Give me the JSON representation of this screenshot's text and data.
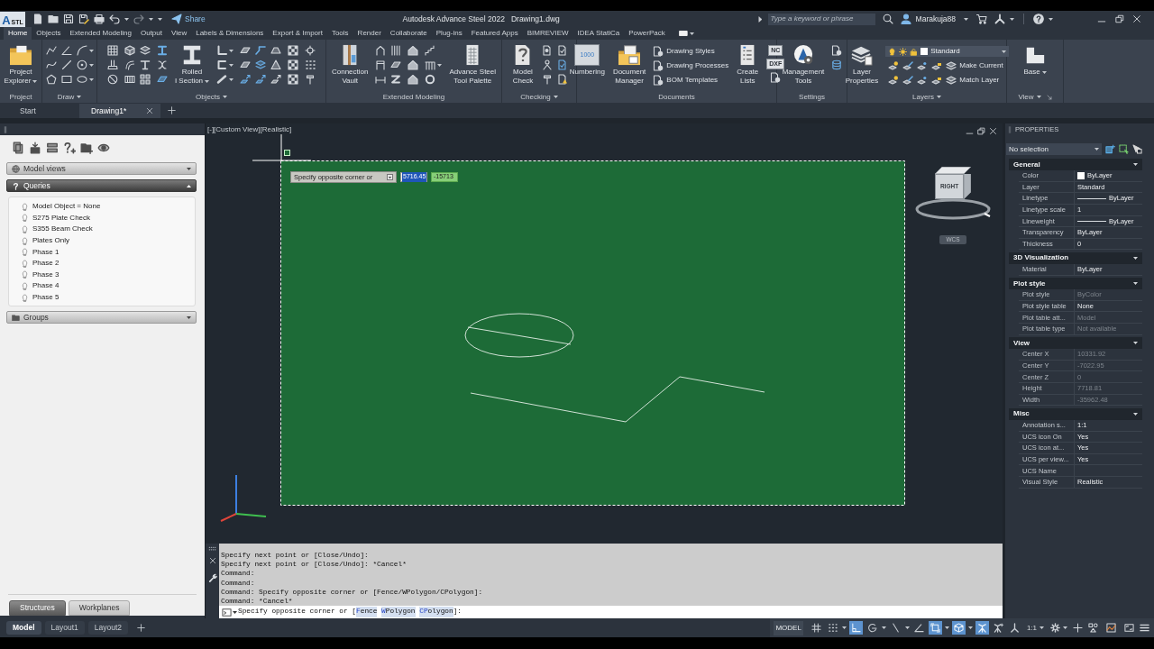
{
  "title_bar": {
    "app_button": {
      "letter": "A",
      "sub": "STL"
    },
    "share": "Share",
    "app_name": "Autodesk Advance Steel 2022",
    "file_name": "Drawing1.dwg",
    "search": {
      "placeholder": "Type a keyword or phrase"
    },
    "user": "Marakuja88"
  },
  "ribbon_tabs": [
    {
      "label": "Home",
      "selected": true
    },
    {
      "label": "Objects",
      "selected": false
    },
    {
      "label": "Extended Modeling",
      "selected": false
    },
    {
      "label": "Output",
      "selected": false
    },
    {
      "label": "View",
      "selected": false
    },
    {
      "label": "Labels & Dimensions",
      "selected": false
    },
    {
      "label": "Export & Import",
      "selected": false
    },
    {
      "label": "Tools",
      "selected": false
    },
    {
      "label": "Render",
      "selected": false
    },
    {
      "label": "Collaborate",
      "selected": false
    },
    {
      "label": "Plug-ins",
      "selected": false
    },
    {
      "label": "Featured Apps",
      "selected": false
    },
    {
      "label": "BIMREVIEW",
      "selected": false
    },
    {
      "label": "IDEA StatiCa",
      "selected": false
    },
    {
      "label": "PowerPack",
      "selected": false
    }
  ],
  "ribbon_panels": [
    {
      "label": "Project",
      "dropdown": false,
      "launcher": false,
      "controls": [
        {
          "kind": "big",
          "lines": [
            "Project",
            "Explorer"
          ],
          "dropdown": true
        }
      ]
    },
    {
      "label": "Draw",
      "dropdown": true,
      "launcher": false,
      "controls": [
        {
          "kind": "icons"
        }
      ]
    },
    {
      "label": "Objects",
      "dropdown": true,
      "launcher": false,
      "controls": [
        {
          "kind": "icons"
        },
        {
          "kind": "icons"
        },
        {
          "kind": "icons"
        },
        {
          "kind": "big",
          "lines": [
            "Rolled",
            "I Section"
          ],
          "dropdown": true
        },
        {
          "kind": "icons"
        },
        {
          "kind": "icons"
        },
        {
          "kind": "icons"
        },
        {
          "kind": "icons"
        }
      ]
    },
    {
      "label": "Extended Modeling",
      "dropdown": false,
      "launcher": false,
      "controls": [
        {
          "kind": "big",
          "lines": [
            "Connection",
            "Vault"
          ],
          "dropdown": false
        },
        {
          "kind": "icons"
        },
        {
          "kind": "icons"
        },
        {
          "kind": "icons"
        },
        {
          "kind": "big",
          "lines": [
            "Advance Steel",
            "Tool Palette"
          ],
          "dropdown": false
        }
      ]
    },
    {
      "label": "Checking",
      "dropdown": true,
      "launcher": false,
      "controls": [
        {
          "kind": "big",
          "lines": [
            "Model",
            "Check"
          ],
          "dropdown": false
        },
        {
          "kind": "icons"
        }
      ]
    },
    {
      "label": "Documents",
      "dropdown": false,
      "launcher": false,
      "controls": [
        {
          "kind": "big",
          "lines": [
            "Numbering"
          ],
          "icon_text": "1000",
          "dropdown": false
        },
        {
          "kind": "big",
          "lines": [
            "Document",
            "Manager"
          ],
          "dropdown": false
        },
        {
          "kind": "list",
          "items": [
            "Drawing Styles",
            "Drawing Processes",
            "BOM Templates"
          ]
        },
        {
          "kind": "big",
          "lines": [
            "Create",
            "Lists"
          ],
          "dropdown": false
        },
        {
          "kind": "file_icons",
          "labels": [
            "NC",
            "DXF"
          ]
        }
      ]
    },
    {
      "label": "Settings",
      "dropdown": false,
      "launcher": false,
      "controls": [
        {
          "kind": "big",
          "lines": [
            "Management",
            "Tools"
          ],
          "dropdown": false
        },
        {
          "kind": "icons"
        }
      ]
    },
    {
      "label": "Layers",
      "dropdown": true,
      "launcher": false,
      "controls": [
        {
          "kind": "big",
          "lines": [
            "Layer",
            "Properties"
          ],
          "dropdown": false
        },
        {
          "kind": "layer_tools",
          "layer": "Standard",
          "actions": [
            "Make Current",
            "Match Layer"
          ]
        }
      ]
    },
    {
      "label": "View",
      "dropdown": true,
      "launcher": true,
      "controls": [
        {
          "kind": "big",
          "lines": [
            "Base"
          ],
          "dropdown": true
        }
      ]
    }
  ],
  "document_tabs": [
    {
      "label": "Start",
      "selected": false,
      "closable": false
    },
    {
      "label": "Drawing1*",
      "selected": true,
      "closable": true
    }
  ],
  "structure_panel": {
    "sections": [
      {
        "title": "Model views",
        "kind": "views",
        "expanded": false
      },
      {
        "title": "Queries",
        "kind": "queries",
        "expanded": true,
        "items": [
          "Model Object = None",
          "S275 Plate Check",
          "S355 Beam Check",
          "Plates Only",
          "Phase 1",
          "Phase 2",
          "Phase 3",
          "Phase 4",
          "Phase 5"
        ]
      },
      {
        "title": "Groups",
        "kind": "groups",
        "expanded": false
      }
    ],
    "tabs": [
      {
        "label": "Structures",
        "selected": true
      },
      {
        "label": "Workplanes",
        "selected": false
      }
    ]
  },
  "viewport": {
    "controls": "[-][Custom View][Realistic]",
    "dynamic_input": {
      "prompt": "Specify opposite corner or",
      "fields": [
        {
          "value": "5716.45",
          "selected": true
        },
        {
          "value": "-15713",
          "selected": false
        }
      ]
    },
    "viewcube": {
      "face": "RIGHT",
      "ucs": "WCS"
    }
  },
  "command_line": {
    "history": [
      "Specify next point or [Close/Undo]:",
      "Specify next point or [Close/Undo]: *Cancel*",
      "Command:",
      "Command:",
      "Command: Specify opposite corner or [Fence/WPolygon/CPolygon]:",
      "Command: *Cancel*"
    ],
    "prompt": {
      "text": "Specify opposite corner or [",
      "options": [
        {
          "key": "F",
          "rest": "ence"
        },
        {
          "key": "W",
          "rest": "Polygon"
        },
        {
          "key": "CP",
          "rest": "olygon"
        }
      ],
      "end": "]:"
    }
  },
  "properties": {
    "title": "PROPERTIES",
    "selection": "No selection",
    "sections": [
      {
        "title": "General",
        "expanded": true,
        "rows": [
          {
            "label": "Color",
            "value": "ByLayer",
            "kind": "swatch",
            "disabled": false
          },
          {
            "label": "Layer",
            "value": "Standard",
            "kind": "text",
            "disabled": false
          },
          {
            "label": "Linetype",
            "value": "ByLayer",
            "kind": "line",
            "disabled": false
          },
          {
            "label": "Linetype scale",
            "value": "1",
            "kind": "text",
            "disabled": false
          },
          {
            "label": "Lineweight",
            "value": "ByLayer",
            "kind": "line",
            "disabled": false
          },
          {
            "label": "Transparency",
            "value": "ByLayer",
            "kind": "text",
            "disabled": false
          },
          {
            "label": "Thickness",
            "value": "0",
            "kind": "text",
            "disabled": false
          }
        ]
      },
      {
        "title": "3D Visualization",
        "expanded": true,
        "rows": [
          {
            "label": "Material",
            "value": "ByLayer",
            "kind": "text",
            "disabled": false
          }
        ]
      },
      {
        "title": "Plot style",
        "expanded": true,
        "rows": [
          {
            "label": "Plot style",
            "value": "ByColor",
            "kind": "text",
            "disabled": true
          },
          {
            "label": "Plot style table",
            "value": "None",
            "kind": "text",
            "disabled": false
          },
          {
            "label": "Plot table att...",
            "value": "Model",
            "kind": "text",
            "disabled": true
          },
          {
            "label": "Plot table type",
            "value": "Not available",
            "kind": "text",
            "disabled": true
          }
        ]
      },
      {
        "title": "View",
        "expanded": true,
        "rows": [
          {
            "label": "Center X",
            "value": "10331.92",
            "kind": "text",
            "disabled": true
          },
          {
            "label": "Center Y",
            "value": "-7022.95",
            "kind": "text",
            "disabled": true
          },
          {
            "label": "Center Z",
            "value": "0",
            "kind": "text",
            "disabled": true
          },
          {
            "label": "Height",
            "value": "7718.81",
            "kind": "text",
            "disabled": true
          },
          {
            "label": "Width",
            "value": "-35962.48",
            "kind": "text",
            "disabled": true
          }
        ]
      },
      {
        "title": "Misc",
        "expanded": true,
        "rows": [
          {
            "label": "Annotation s...",
            "value": "1:1",
            "kind": "text",
            "disabled": false
          },
          {
            "label": "UCS icon On",
            "value": "Yes",
            "kind": "text",
            "disabled": false
          },
          {
            "label": "UCS icon at...",
            "value": "Yes",
            "kind": "text",
            "disabled": false
          },
          {
            "label": "UCS per view...",
            "value": "Yes",
            "kind": "text",
            "disabled": false
          },
          {
            "label": "UCS Name",
            "kind": "text",
            "disabled": false
          },
          {
            "label": "Visual Style",
            "value": "Realistic",
            "kind": "text",
            "disabled": false
          }
        ]
      }
    ]
  },
  "status_bar": {
    "layouts": [
      {
        "label": "Model",
        "selected": true
      },
      {
        "label": "Layout1",
        "selected": false
      },
      {
        "label": "Layout2",
        "selected": false
      }
    ],
    "space": "MODEL",
    "toggles": [
      {
        "kind": "grid",
        "on": false,
        "dropdown": false
      },
      {
        "kind": "snap",
        "on": false,
        "dropdown": true
      },
      {
        "kind": "ortho",
        "on": true,
        "dropdown": false
      },
      {
        "kind": "polar",
        "on": false,
        "dropdown": true
      },
      {
        "kind": "isodraft",
        "on": false,
        "dropdown": true
      },
      {
        "kind": "angle",
        "on": false,
        "dropdown": false
      },
      {
        "kind": "osnap",
        "on": true,
        "dropdown": true
      },
      {
        "kind": "osnap3d",
        "on": true,
        "dropdown": true
      },
      {
        "kind": "annovis",
        "on": true,
        "dropdown": false
      },
      {
        "kind": "annoauto",
        "on": false,
        "dropdown": false
      },
      {
        "kind": "annoscale",
        "on": false,
        "dropdown": false
      }
    ],
    "scale": "1:1"
  }
}
